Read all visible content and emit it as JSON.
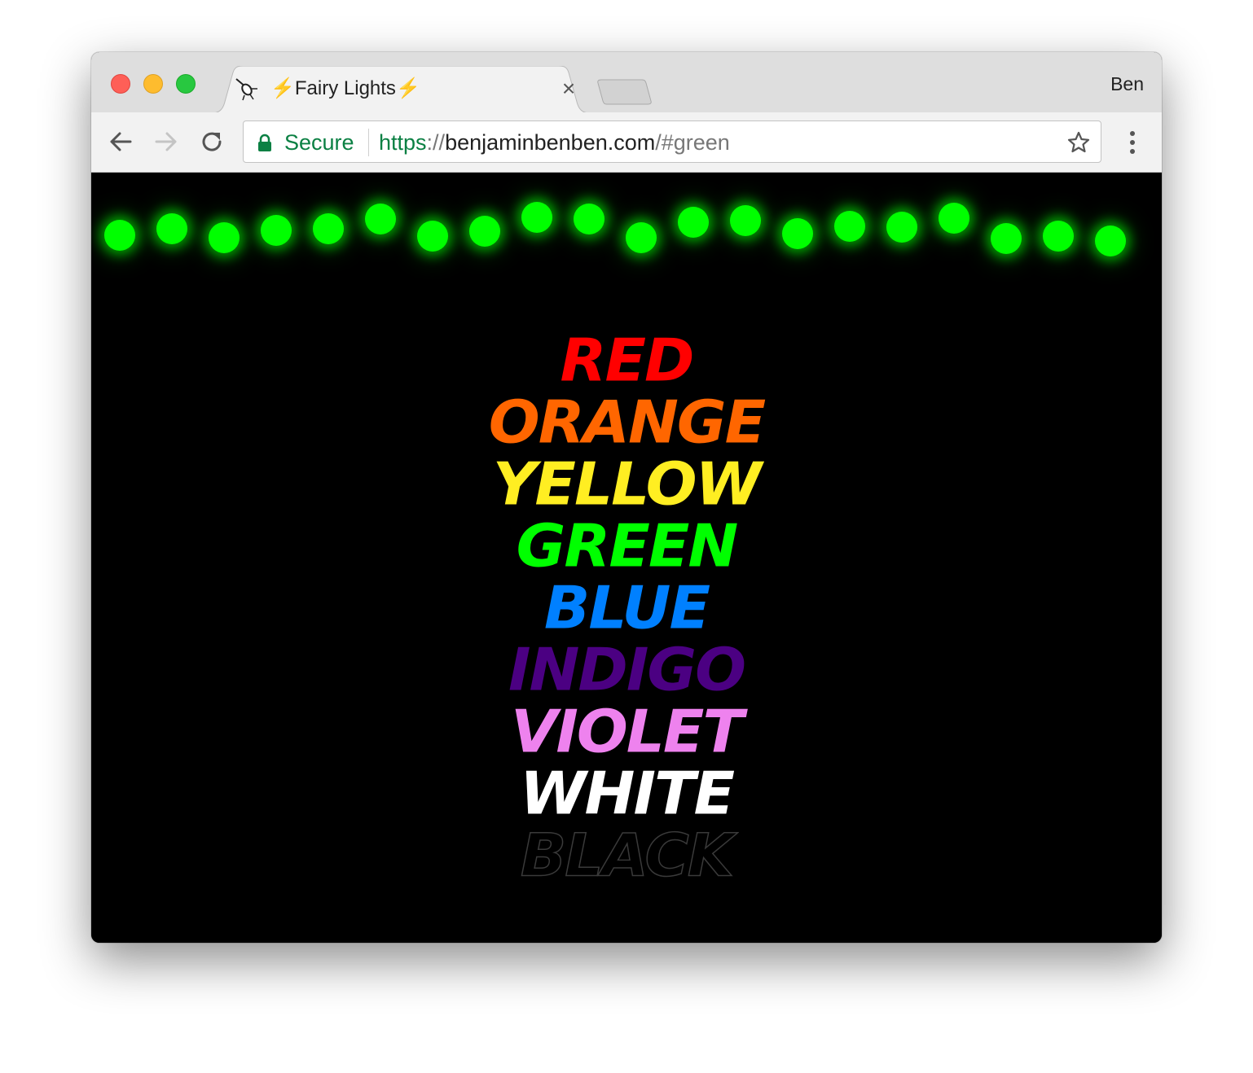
{
  "browser": {
    "tab": {
      "title_prefix": "⚡",
      "title": "Fairy Lights",
      "title_suffix": "⚡",
      "close_symbol": "×"
    },
    "profile_name": "Ben",
    "omnibox": {
      "secure_label": "Secure",
      "url_scheme": "https",
      "url_separator": "://",
      "url_host": "benjaminbenben.com",
      "url_path": "/#green"
    },
    "icons": {
      "back": "back-arrow-icon",
      "forward": "forward-arrow-icon",
      "reload": "reload-icon",
      "lock": "lock-icon",
      "star": "star-icon",
      "menu": "more-vert-icon",
      "favicon": "fairy-lights-favicon"
    },
    "traffic_light_colors": [
      "#fe5f57",
      "#febc2e",
      "#28c840"
    ]
  },
  "page": {
    "background": "#000000",
    "lights": {
      "count": 20,
      "color": "#00ff00",
      "vertical_offsets": [
        0,
        -8,
        3,
        -6,
        -8,
        -20,
        1,
        -5,
        -22,
        -20,
        3,
        -16,
        -18,
        -2,
        -11,
        -10,
        -21,
        4,
        1,
        7
      ]
    },
    "color_words": [
      {
        "label": "RED",
        "color": "#ff0000",
        "outline_only": false
      },
      {
        "label": "ORANGE",
        "color": "#ff6600",
        "outline_only": false
      },
      {
        "label": "YELLOW",
        "color": "#ffee22",
        "outline_only": false
      },
      {
        "label": "GREEN",
        "color": "#00ff00",
        "outline_only": false
      },
      {
        "label": "BLUE",
        "color": "#0080ff",
        "outline_only": false
      },
      {
        "label": "INDIGO",
        "color": "#4b0082",
        "outline_only": false
      },
      {
        "label": "VIOLET",
        "color": "#ee82ee",
        "outline_only": false
      },
      {
        "label": "WHITE",
        "color": "#ffffff",
        "outline_only": false
      },
      {
        "label": "BLACK",
        "color": "#000000",
        "outline_only": true
      }
    ]
  }
}
